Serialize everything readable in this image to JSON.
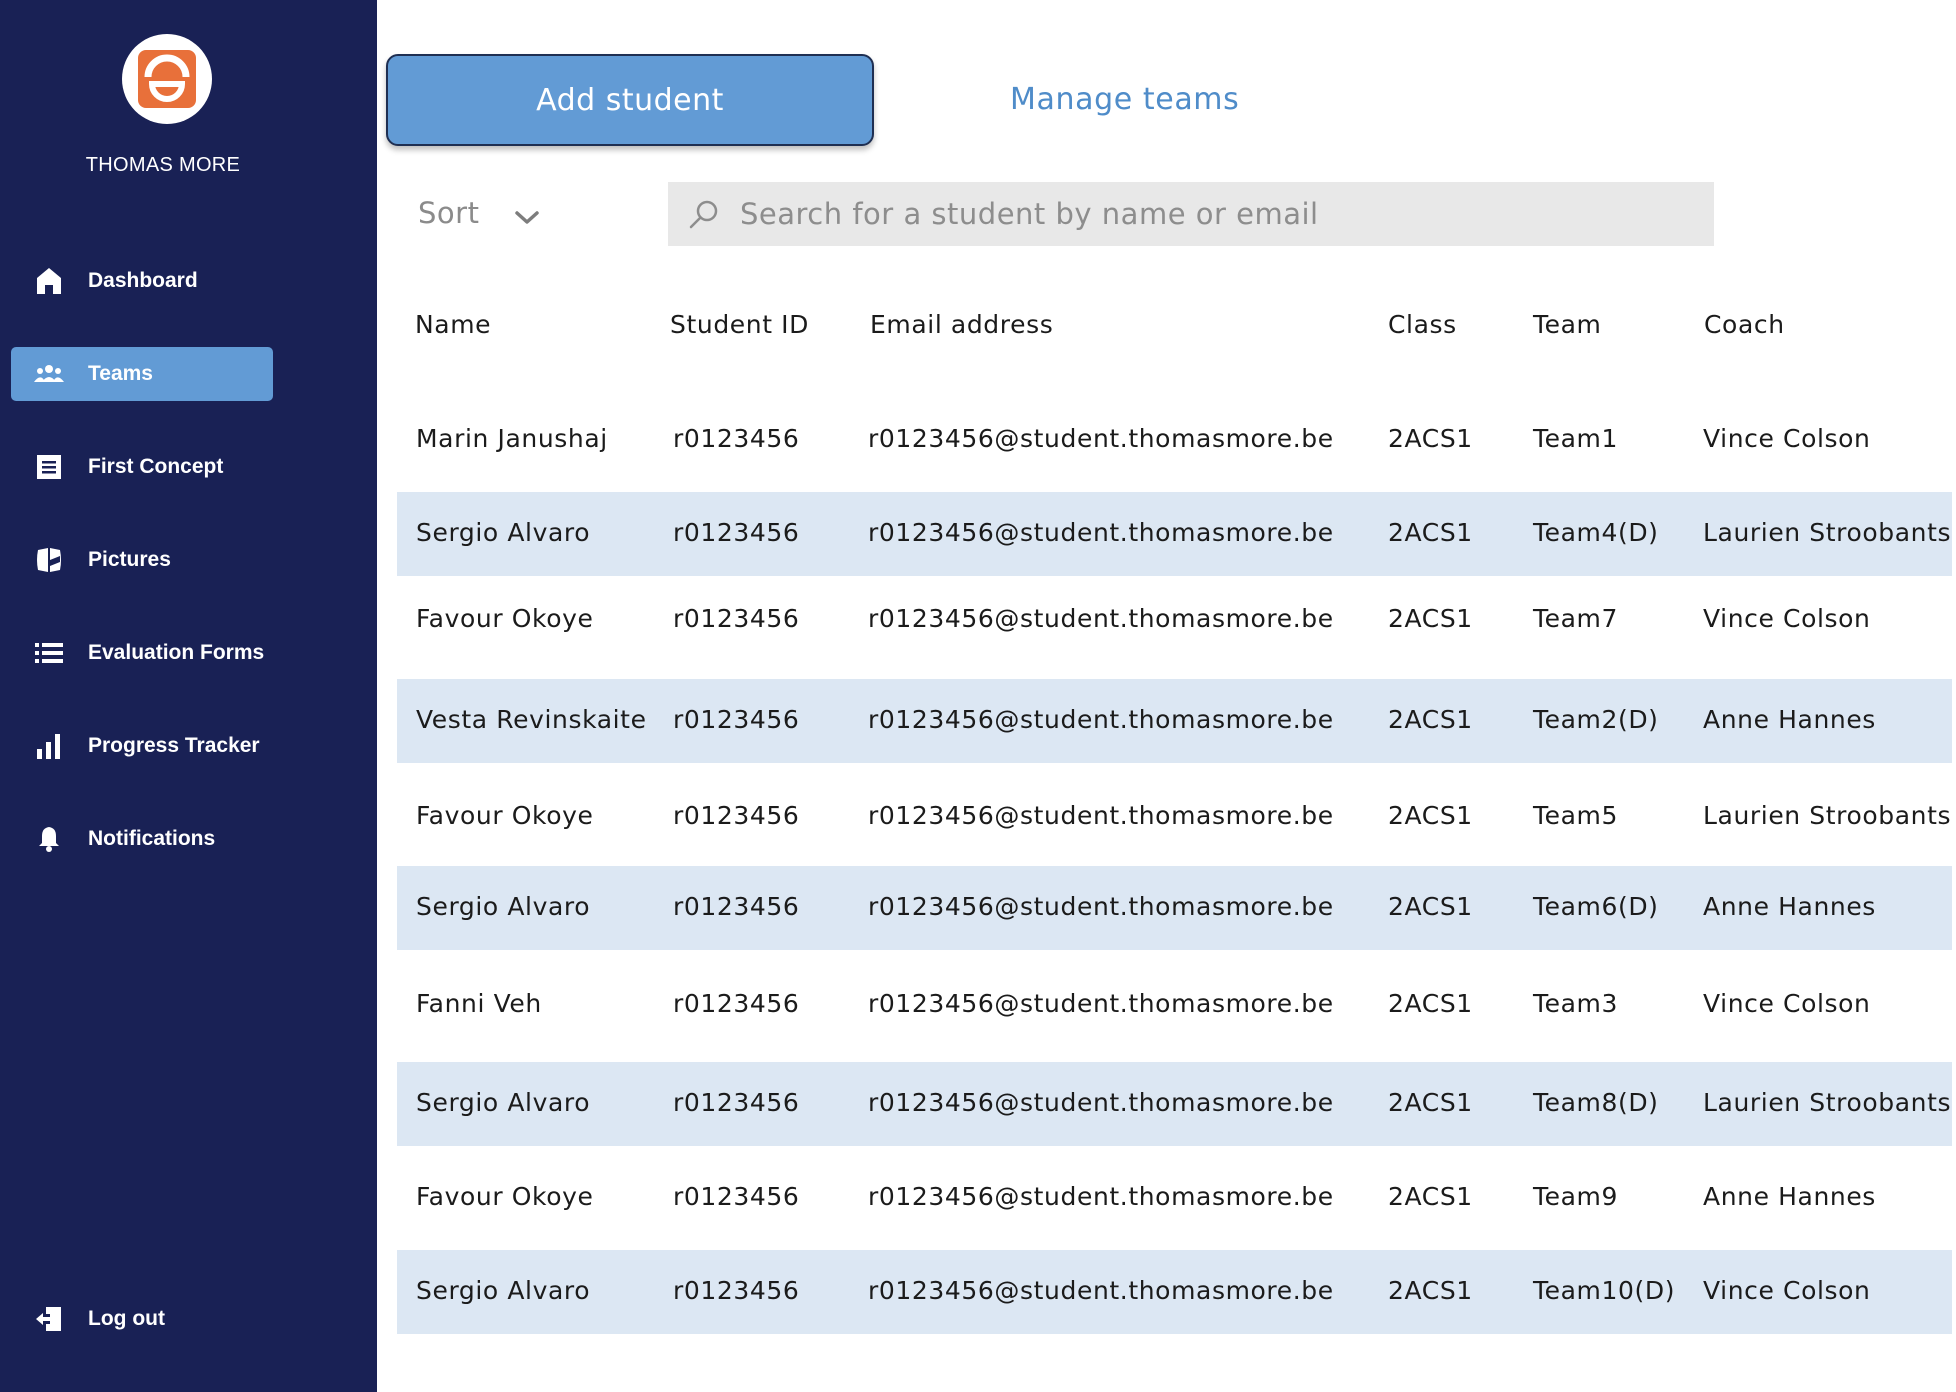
{
  "sidebar": {
    "brand": "THOMAS MORE",
    "items": [
      {
        "label": "Dashboard",
        "icon": "home-icon",
        "active": false
      },
      {
        "label": "Teams",
        "icon": "people-icon",
        "active": true
      },
      {
        "label": "First Concept",
        "icon": "document-icon",
        "active": false
      },
      {
        "label": "Pictures",
        "icon": "pictures-icon",
        "active": false
      },
      {
        "label": "Evaluation Forms",
        "icon": "list-icon",
        "active": false
      },
      {
        "label": "Progress Tracker",
        "icon": "bar-chart-icon",
        "active": false
      },
      {
        "label": "Notifications",
        "icon": "bell-icon",
        "active": false
      }
    ],
    "logout": {
      "label": "Log out",
      "icon": "logout-icon"
    }
  },
  "toolbar": {
    "add_student_label": "Add student",
    "manage_teams_label": "Manage teams"
  },
  "sort": {
    "label": "Sort"
  },
  "search": {
    "placeholder": "Search for a student by name or email"
  },
  "table": {
    "headers": [
      "Name",
      "Student ID",
      "Email address",
      "Class",
      "Team",
      "Coach"
    ],
    "rows": [
      {
        "name": "Marin Janushaj",
        "id": "r0123456",
        "email": "r0123456@student.thomasmore.be",
        "class": "2ACS1",
        "team": "Team1",
        "coach": "Vince Colson",
        "shaded": false
      },
      {
        "name": "Sergio Alvaro",
        "id": "r0123456",
        "email": "r0123456@student.thomasmore.be",
        "class": "2ACS1",
        "team": "Team4(D)",
        "coach": "Laurien Stroobants",
        "shaded": true
      },
      {
        "name": "Favour Okoye",
        "id": "r0123456",
        "email": "r0123456@student.thomasmore.be",
        "class": "2ACS1",
        "team": "Team7",
        "coach": "Vince Colson",
        "shaded": false
      },
      {
        "name": "Vesta Revinskaite",
        "id": "r0123456",
        "email": "r0123456@student.thomasmore.be",
        "class": "2ACS1",
        "team": "Team2(D)",
        "coach": "Anne Hannes",
        "shaded": true
      },
      {
        "name": "Favour Okoye",
        "id": "r0123456",
        "email": "r0123456@student.thomasmore.be",
        "class": "2ACS1",
        "team": "Team5",
        "coach": "Laurien Stroobants",
        "shaded": false
      },
      {
        "name": "Sergio Alvaro",
        "id": "r0123456",
        "email": "r0123456@student.thomasmore.be",
        "class": "2ACS1",
        "team": "Team6(D)",
        "coach": "Anne Hannes",
        "shaded": true
      },
      {
        "name": "Fanni Veh",
        "id": "r0123456",
        "email": "r0123456@student.thomasmore.be",
        "class": "2ACS1",
        "team": "Team3",
        "coach": "Vince Colson",
        "shaded": false
      },
      {
        "name": "Sergio Alvaro",
        "id": "r0123456",
        "email": "r0123456@student.thomasmore.be",
        "class": "2ACS1",
        "team": "Team8(D)",
        "coach": "Laurien Stroobants",
        "shaded": true
      },
      {
        "name": "Favour Okoye",
        "id": "r0123456",
        "email": "r0123456@student.thomasmore.be",
        "class": "2ACS1",
        "team": "Team9",
        "coach": "Anne Hannes",
        "shaded": false
      },
      {
        "name": "Sergio Alvaro",
        "id": "r0123456",
        "email": "r0123456@student.thomasmore.be",
        "class": "2ACS1",
        "team": "Team10(D)",
        "coach": "Vince Colson",
        "shaded": true
      }
    ]
  },
  "colors": {
    "sidebar_bg": "#192155",
    "accent": "#629bd5",
    "link": "#4f8cc9",
    "row_shade": "#dce7f3",
    "logo": "#e8703a"
  }
}
